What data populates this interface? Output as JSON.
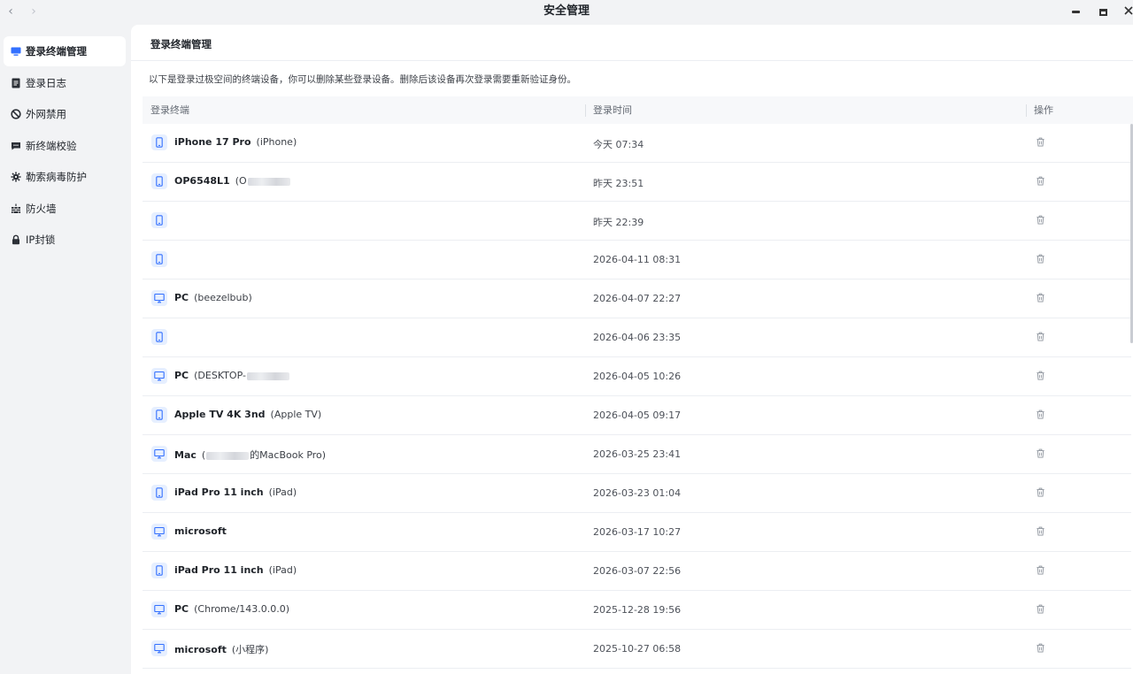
{
  "window": {
    "title": "安全管理",
    "back_glyph": "‹",
    "forward_glyph": "›"
  },
  "sidebar": {
    "items": [
      {
        "label": "登录终端管理",
        "icon": "monitor-icon",
        "active": true
      },
      {
        "label": "登录日志",
        "icon": "document-icon",
        "active": false
      },
      {
        "label": "外网禁用",
        "icon": "ban-icon",
        "active": false
      },
      {
        "label": "新终端校验",
        "icon": "message-icon",
        "active": false
      },
      {
        "label": "勒索病毒防护",
        "icon": "gear-shield-icon",
        "active": false
      },
      {
        "label": "防火墙",
        "icon": "firewall-icon",
        "active": false
      },
      {
        "label": "IP封锁",
        "icon": "lock-icon",
        "active": false
      }
    ]
  },
  "main": {
    "title": "登录终端管理",
    "description": "以下是登录过极空间的终端设备，你可以删除某些登录设备。删除后该设备再次登录需要重新验证身份。",
    "columns": {
      "terminal": "登录终端",
      "time": "登录时间",
      "action": "操作"
    },
    "rows": [
      {
        "type": "phone",
        "name": "iPhone 17 Pro",
        "sub": "(iPhone)",
        "time": "今天 07:34"
      },
      {
        "type": "phone",
        "name": "OP6548L1",
        "sub_prefix": "(O",
        "sub": "",
        "redacted": true,
        "time": "昨天 23:51"
      },
      {
        "type": "phone",
        "name": "",
        "sub": "",
        "time": "昨天 22:39"
      },
      {
        "type": "phone",
        "name": "",
        "sub": "",
        "time": "2026-04-11 08:31"
      },
      {
        "type": "pc",
        "name": "PC",
        "sub": "(beezelbub)",
        "time": "2026-04-07 22:27"
      },
      {
        "type": "phone",
        "name": "",
        "sub": "",
        "time": "2026-04-06 23:35"
      },
      {
        "type": "pc",
        "name": "PC",
        "sub_prefix": "(DESKTOP-",
        "sub": "",
        "redacted": true,
        "time": "2026-04-05 10:26"
      },
      {
        "type": "phone",
        "name": "Apple TV 4K 3nd",
        "sub": "(Apple TV)",
        "time": "2026-04-05 09:17"
      },
      {
        "type": "pc",
        "name": "Mac",
        "sub_prefix": "(",
        "sub_suffix": "的MacBook Pro)",
        "sub": "",
        "redacted": true,
        "time": "2026-03-25 23:41"
      },
      {
        "type": "phone",
        "name": "iPad Pro 11 inch",
        "sub": "(iPad)",
        "time": "2026-03-23 01:04"
      },
      {
        "type": "pc",
        "name": "microsoft",
        "sub": "",
        "time": "2026-03-17 10:27"
      },
      {
        "type": "phone",
        "name": "iPad Pro 11 inch",
        "sub": "(iPad)",
        "time": "2026-03-07 22:56"
      },
      {
        "type": "pc",
        "name": "PC",
        "sub": "(Chrome/143.0.0.0)",
        "time": "2025-12-28 19:56"
      },
      {
        "type": "pc",
        "name": "microsoft",
        "sub": "(小程序)",
        "time": "2025-10-27 06:58"
      }
    ]
  },
  "colors": {
    "accent": "#3370ff",
    "icon_bg": "#e6efff",
    "active_bg": "#ffffff",
    "sidebar_bg": "#f2f3f5"
  }
}
